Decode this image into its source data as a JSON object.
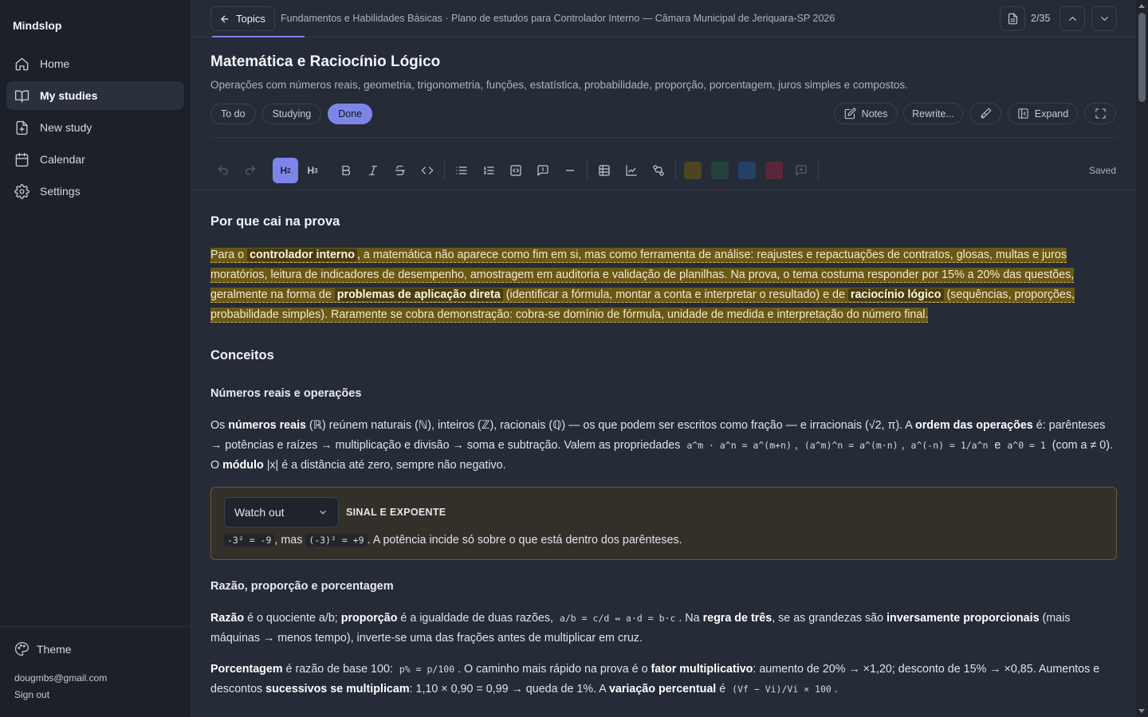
{
  "app": {
    "name": "Mindslop"
  },
  "sidebar": {
    "items": [
      {
        "label": "Home",
        "icon": "home-icon"
      },
      {
        "label": "My studies",
        "icon": "book-icon",
        "active": true
      },
      {
        "label": "New study",
        "icon": "file-plus-icon"
      },
      {
        "label": "Calendar",
        "icon": "calendar-icon"
      },
      {
        "label": "Settings",
        "icon": "gear-icon"
      }
    ],
    "theme_label": "Theme",
    "email": "dougmbs@gmail.com",
    "signout_label": "Sign out"
  },
  "topbar": {
    "back_label": "Topics",
    "breadcrumb": "Fundamentos e Habilidades Básicas · Plano de estudos para Controlador Interno — Câmara Municipal de Jeriquara-SP 2026",
    "page_count": "2/35"
  },
  "header": {
    "title": "Matemática e Raciocínio Lógico",
    "subtitle": "Operações com números reais, geometria, trigonometria, funções, estatística, probabilidade, proporção, porcentagem, juros simples e compostos.",
    "status": [
      {
        "label": "To do",
        "active": false
      },
      {
        "label": "Studying",
        "active": false
      },
      {
        "label": "Done",
        "active": true
      }
    ],
    "actions": {
      "notes": "Notes",
      "rewrite": "Rewrite...",
      "expand": "Expand"
    }
  },
  "toolbar": {
    "h2": "H",
    "h2_sub": "2",
    "h3": "H",
    "h3_sub": "3",
    "saved": "Saved",
    "colors": [
      "#4f4422",
      "#24423a",
      "#263f66",
      "#5b2539"
    ]
  },
  "content": {
    "section1_title": "Por que cai na prova",
    "p1": {
      "t1": "Para o ",
      "b1": "controlador interno",
      "t2": ", a matemática não aparece como fim em si, mas como ferramenta de análise: reajustes e repactuações de contratos, glosas, multas e juros moratórios, leitura de indicadores de desempenho, amostragem em auditoria e validação de planilhas. Na prova, o tema costuma responder por 15% a 20% das questões, geralmente na forma de ",
      "b2": "problemas de aplicação direta",
      "t3": " (identificar a fórmula, montar a conta e interpretar o resultado) e de ",
      "b3": "raciocínio lógico",
      "t4": " (sequências, proporções, probabilidade simples). Raramente se cobra demonstração: cobra-se domínio de fórmula, unidade de medida e interpretação do número final."
    },
    "section2_title": "Conceitos",
    "sub1_title": "Números reais e operações",
    "p2": {
      "t1": "Os ",
      "b1": "números reais",
      "t2": " (ℝ) reúnem naturais (ℕ), inteiros (ℤ), racionais (ℚ) — os que podem ser escritos como fração — e irracionais (√2, π). A ",
      "b2": "ordem das operações",
      "t3": " é: parênteses → potências e raízes → multiplicação e divisão → soma e subtração. Valem as propriedades ",
      "c1": "a^m · a^n = a^(m+n)",
      "t4": ", ",
      "c2": "(a^m)^n = a^(m·n)",
      "t5": ", ",
      "c3": "a^(-n) = 1/a^n",
      "t6": " e ",
      "c4": "a^0 = 1",
      "t7": " (com a ≠ 0). O ",
      "b3": "módulo",
      "t8": " |x| é a distância até zero, sempre não negativo."
    },
    "callout": {
      "type": "Watch out",
      "title": "SINAL E EXPOENTE",
      "c1": "-3² = -9",
      "t1": ", mas ",
      "c2": "(-3)² = +9",
      "t2": ". A potência incide só sobre o que está dentro dos parênteses."
    },
    "sub2_title": "Razão, proporção e porcentagem",
    "p3": {
      "b1": "Razão",
      "t1": " é o quociente a/b; ",
      "b2": "proporção",
      "t2": " é a igualdade de duas razões, ",
      "c1": "a/b = c/d ⇔ a·d = b·c",
      "t3": ". Na ",
      "b3": "regra de três",
      "t4": ", se as grandezas são ",
      "b4": "inversamente proporcionais",
      "t5": " (mais máquinas → menos tempo), inverte-se uma das frações antes de multiplicar em cruz."
    },
    "p4": {
      "b1": "Porcentagem",
      "t1": " é razão de base 100: ",
      "c1": "p% = p/100",
      "t2": ". O caminho mais rápido na prova é o ",
      "b2": "fator multiplicativo",
      "t3": ": aumento de 20% → ×1,20; desconto de 15% → ×0,85. Aumentos e descontos ",
      "b3": "sucessivos se multiplicam",
      "t4": ": 1,10 × 0,90 = 0,99 → queda de 1%. A ",
      "b4": "variação percentual",
      "t5": " é ",
      "c2": "(Vf − Vi)/Vi × 100",
      "t6": "."
    }
  }
}
